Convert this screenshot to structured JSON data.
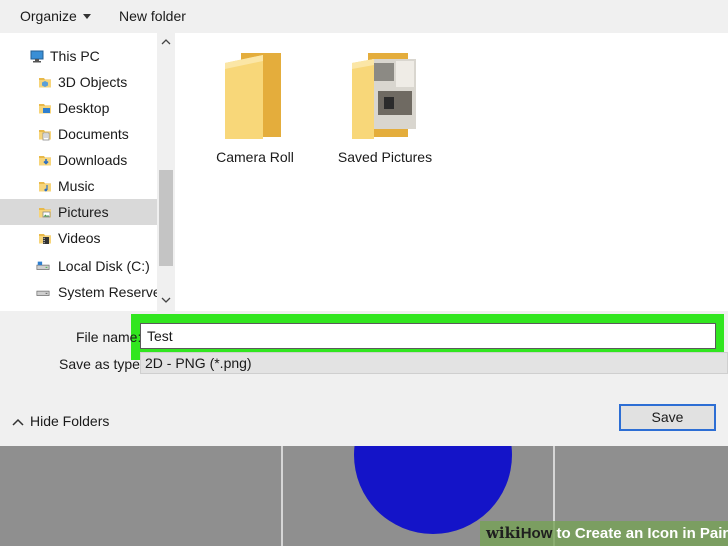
{
  "toolbar": {
    "organize_label": "Organize",
    "new_folder_label": "New folder"
  },
  "nav": {
    "items": [
      {
        "label": "This PC",
        "icon": "computer-icon"
      },
      {
        "label": "3D Objects",
        "icon": "folder-icon"
      },
      {
        "label": "Desktop",
        "icon": "desktop-folder-icon"
      },
      {
        "label": "Documents",
        "icon": "documents-folder-icon"
      },
      {
        "label": "Downloads",
        "icon": "downloads-folder-icon"
      },
      {
        "label": "Music",
        "icon": "music-folder-icon"
      },
      {
        "label": "Pictures",
        "icon": "pictures-folder-icon"
      },
      {
        "label": "Videos",
        "icon": "videos-folder-icon"
      },
      {
        "label": "Local Disk (C:)",
        "icon": "drive-icon"
      },
      {
        "label": "System Reserved",
        "icon": "drive-icon"
      }
    ],
    "selected": "Pictures"
  },
  "folders": [
    {
      "label": "Camera Roll",
      "icon": "folder-icon"
    },
    {
      "label": "Saved Pictures",
      "icon": "folder-with-picture-icon"
    }
  ],
  "form": {
    "file_name_label": "File name:",
    "file_name_value": "Test",
    "save_as_type_label": "Save as type:",
    "save_as_type_value": "2D - PNG (*.png)"
  },
  "footer": {
    "hide_folders_label": "Hide Folders",
    "save_label": "Save"
  },
  "watermark": {
    "wiki": "wiki",
    "how": "How",
    "rest": " to Create an Icon in Paint"
  },
  "colors": {
    "highlight": "#31e61f",
    "circle": "#1414c8",
    "save_border": "#2d6ed4"
  }
}
